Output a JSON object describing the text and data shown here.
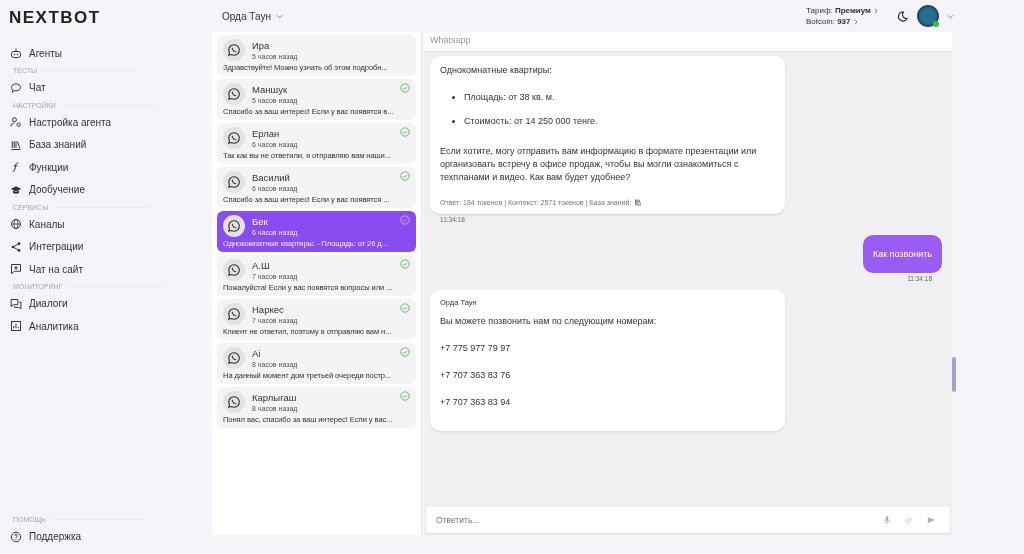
{
  "brand": {
    "name": "NEXTBOT"
  },
  "sidebar": {
    "sections": [
      {
        "items": [
          {
            "label": "Агенты"
          }
        ]
      },
      {
        "title": "ТЕСТЫ",
        "items": [
          {
            "label": "Чат"
          }
        ]
      },
      {
        "title": "НАСТРОЙКИ",
        "items": [
          {
            "label": "Настройка агента"
          },
          {
            "label": "База знаний"
          },
          {
            "label": "Функции"
          },
          {
            "label": "Дообучение"
          }
        ]
      },
      {
        "title": "СЕРВИСЫ",
        "items": [
          {
            "label": "Каналы"
          },
          {
            "label": "Интеграции"
          },
          {
            "label": "Чат на сайт"
          }
        ]
      },
      {
        "title": "МОНИТОРИНГ",
        "items": [
          {
            "label": "Диалоги"
          },
          {
            "label": "Аналитика"
          }
        ]
      }
    ],
    "footer": {
      "title": "ПОМОЩЬ",
      "items": [
        {
          "label": "Поддержка"
        }
      ]
    }
  },
  "topbar": {
    "project": "Орда Таун",
    "tariff_label": "Тариф:",
    "tariff": "Премиум",
    "botcoin_label": "Botcoin:",
    "botcoin": "937"
  },
  "conversations": [
    {
      "name": "Ира",
      "time": "5 часов назад",
      "preview": "Здравствуйте! Можно узнать об этом подробн...",
      "answered": false,
      "selected": false
    },
    {
      "name": "Маншук",
      "time": "5 часов назад",
      "preview": "Спасибо за ваш интерес! Если у вас появятся в...",
      "answered": true,
      "selected": false
    },
    {
      "name": "Ерлан",
      "time": "6 часов назад",
      "preview": "Так как вы не ответили, я отправляю вам наши...",
      "answered": true,
      "selected": false
    },
    {
      "name": "Василий",
      "time": "6 часов назад",
      "preview": "Спасибо за ваш интерес! Если у вас появятся ...",
      "answered": true,
      "selected": false
    },
    {
      "name": "Бек",
      "time": "6 часов назад",
      "preview": "Однокомнатные квартиры: - Площадь: от 26 д...",
      "answered": true,
      "selected": true
    },
    {
      "name": "А.Ш",
      "time": "7 часов назад",
      "preview": "Пожалуйста! Если у вас появятся вопросы или ...",
      "answered": true,
      "selected": false
    },
    {
      "name": "Наркес",
      "time": "7 часов назад",
      "preview": "Клиент не ответил, поэтому я отправляю вам н...",
      "answered": true,
      "selected": false
    },
    {
      "name": "Ai",
      "time": "8 часов назад",
      "preview": "На данный момент дом третьей очереди постр...",
      "answered": true,
      "selected": false
    },
    {
      "name": "Карлыгаш",
      "time": "8 часов назад",
      "preview": "Понял вас, спасибо за ваш интерес! Если у вас...",
      "answered": true,
      "selected": false
    }
  ],
  "chat": {
    "channel": "Whatsapp",
    "messages": [
      {
        "kind": "bot",
        "blocks": [
          {
            "kind": "text",
            "text": "Однокомнатные квартиры:"
          },
          {
            "kind": "list",
            "items": [
              "Площадь: от 38 кв. м.",
              "Стоимость: от 14 250 000 тенге."
            ]
          },
          {
            "kind": "text",
            "text": "Если хотите, могу отправить вам информацию в формате презентации или организовать встречу в офисе продаж, чтобы вы могли ознакомиться с техпланами и видео. Как вам будет удобнее?"
          }
        ],
        "meta": "Ответ: 184 токенов | Контекст: 2571 токенов | База знаний:",
        "time": "11:34:18"
      },
      {
        "kind": "user",
        "text": "Как позвонить",
        "time": "11:34:18"
      },
      {
        "kind": "bot",
        "sender": "Орда Таун",
        "blocks": [
          {
            "kind": "text",
            "text": "Вы можете позвонить нам по следующим номерам:"
          },
          {
            "kind": "text",
            "text": "+7 775 977 79 97"
          },
          {
            "kind": "text",
            "text": "+7 707 363 83 76"
          },
          {
            "kind": "text",
            "text": "+7 707 363 83 94"
          }
        ]
      }
    ],
    "input": {
      "placeholder": "Ответить..."
    }
  }
}
